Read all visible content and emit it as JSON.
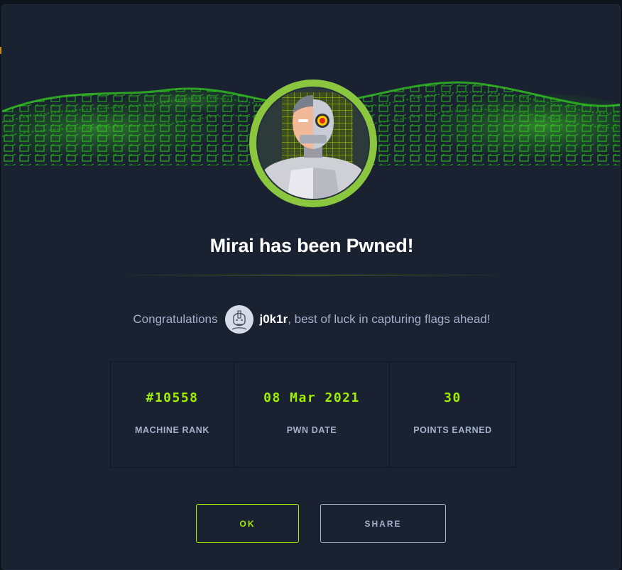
{
  "modal": {
    "title": "Mirai has been Pwned!",
    "congrats_prefix": "Congratulations",
    "username": "j0k1r",
    "congrats_suffix": ", best of luck in capturing flags ahead!"
  },
  "stats": [
    {
      "value": "#10558",
      "label": "MACHINE RANK"
    },
    {
      "value": "08 Mar 2021",
      "label": "PWN DATE"
    },
    {
      "value": "30",
      "label": "POINTS EARNED"
    }
  ],
  "buttons": {
    "ok_label": "OK",
    "share_label": "SHARE"
  },
  "icons": {
    "machine_avatar": "cyborg-avatar-icon",
    "user_avatar": "user-avatar-icon"
  },
  "colors": {
    "accent": "#9fef00",
    "background": "#1a2130",
    "muted_text": "#a4b1cd"
  }
}
